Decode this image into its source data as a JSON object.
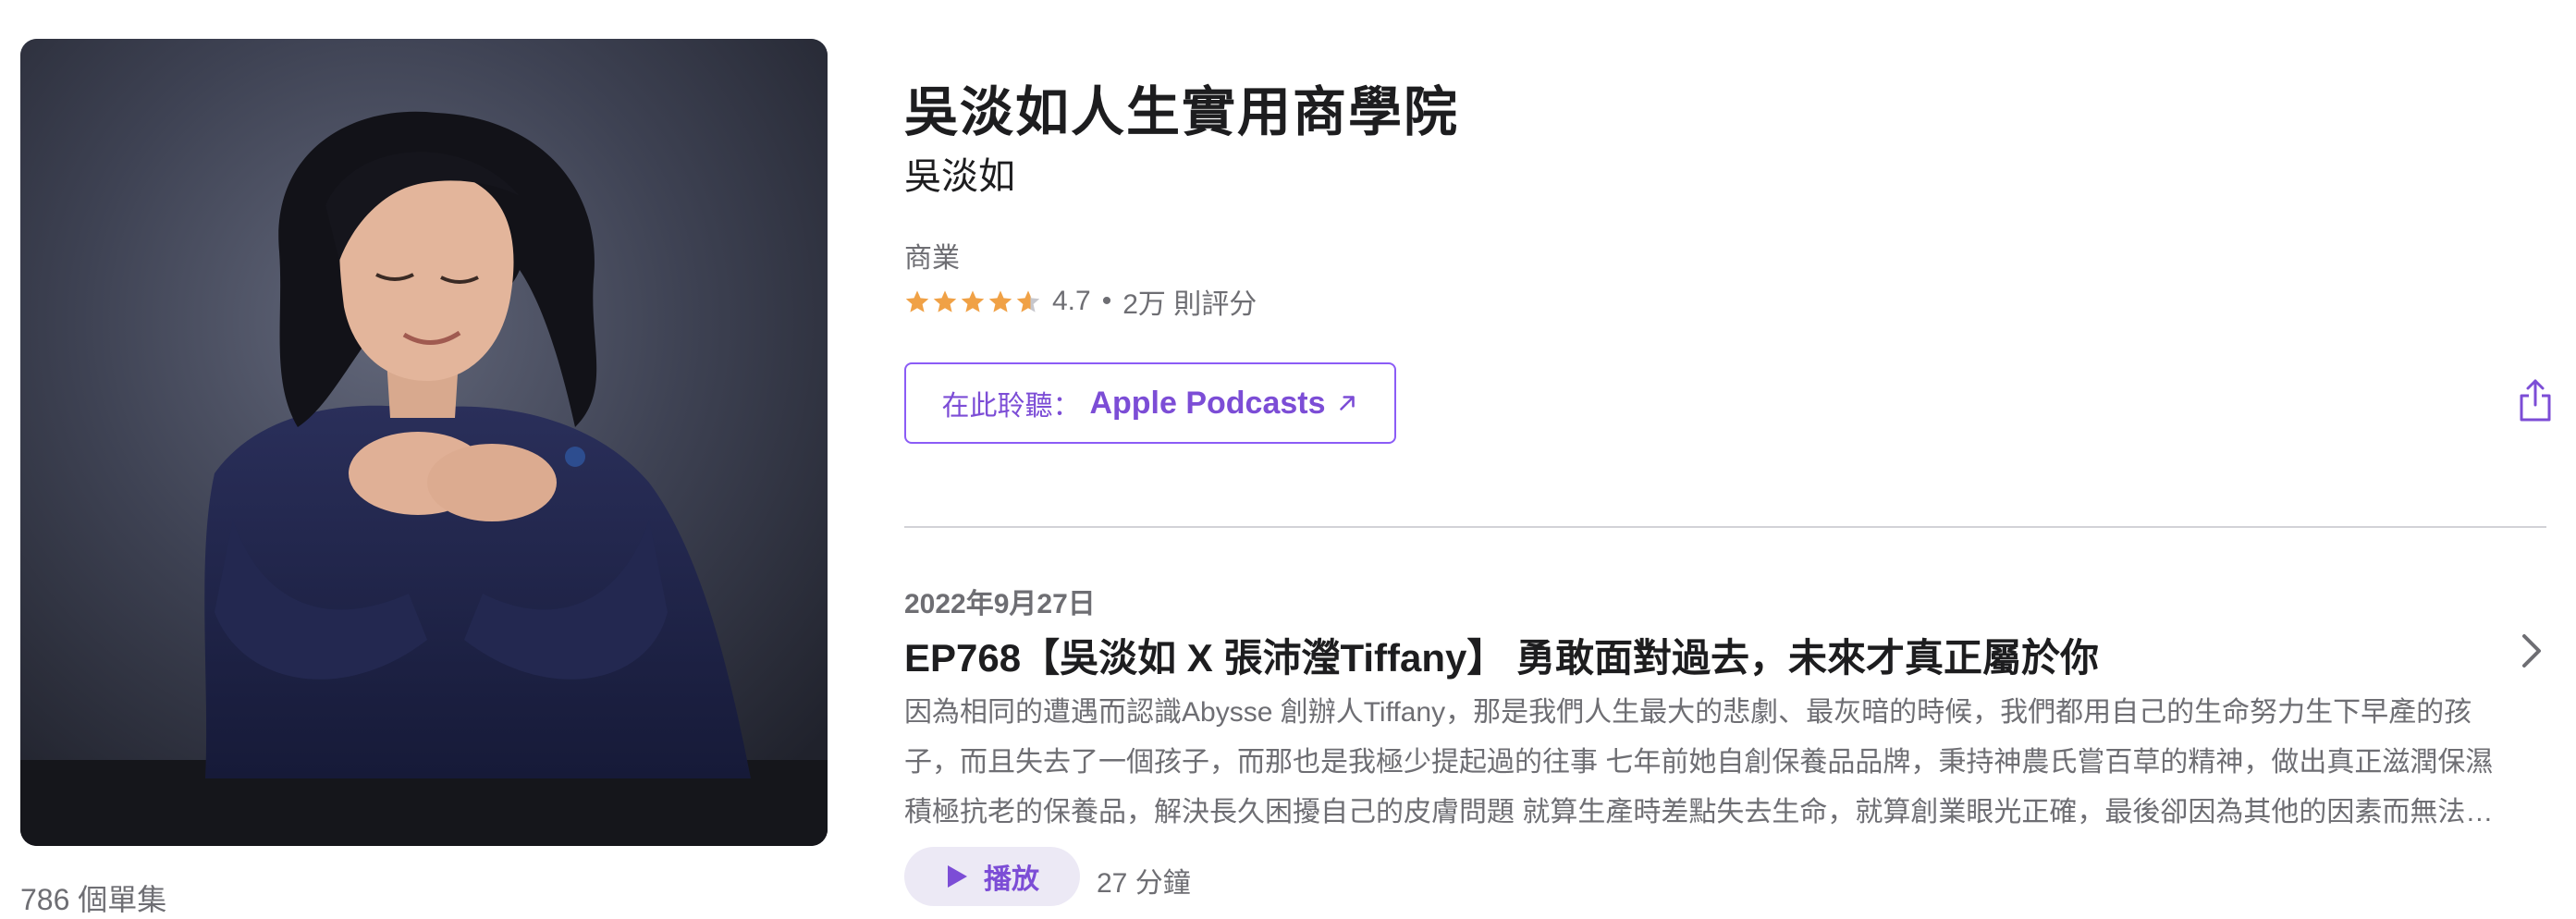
{
  "podcast": {
    "title": "吳淡如人生實用商學院",
    "author": "吳淡如",
    "category": "商業",
    "rating": "4.7",
    "rating_value": 4.7,
    "rating_separator": "•",
    "rating_count": "2万 則評分",
    "episode_count": "786 個單集"
  },
  "listen": {
    "prefix": "在此聆聽：",
    "app": "Apple Podcasts"
  },
  "episode": {
    "date": "2022年9月27日",
    "title": "EP768【吳淡如 X 張沛瀅Tiffany】 勇敢面對過去，未來才真正屬於你",
    "description": "因為相同的遭遇而認識Abysse 創辦人Tiffany，那是我們人生最大的悲劇、最灰暗的時候，我們都用自己的生命努力生下早產的孩子，而且失去了一個孩子，而那也是我極少提起過的往事 七年前她自創保養品品牌，秉持神農氏嘗百草的精神，做出真正滋潤保濕積極抗老的保養品，解決長久困擾自己的皮膚問題 就算生產時差點失去生命，就算創業眼光正確，最後卻因為其他的因素而無法堅持，但是她們依然不放棄……",
    "play_label": "播放",
    "duration": "27 分鐘"
  },
  "colors": {
    "accent": "#7c4dd6",
    "star": "#f0a146",
    "secondary_text": "#6e6e73"
  },
  "icons": [
    "star-icon",
    "arrow-up-right-icon",
    "share-icon",
    "chevron-right-icon",
    "play-icon"
  ]
}
